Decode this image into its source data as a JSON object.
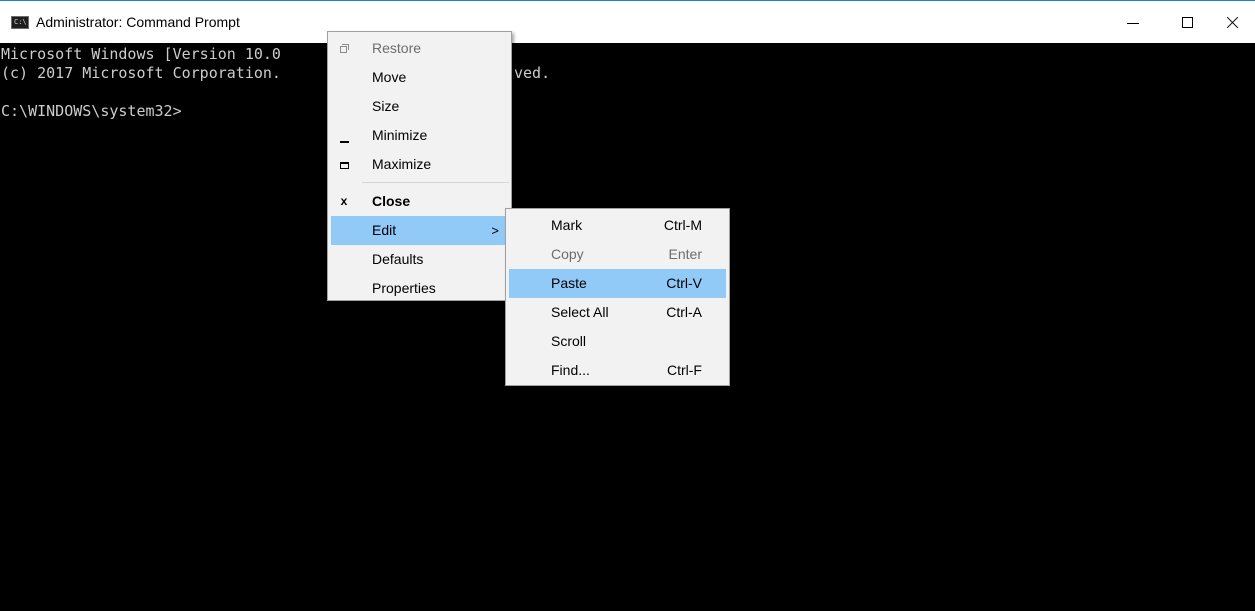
{
  "window": {
    "title": "Administrator: Command Prompt",
    "icon": "cmd-icon",
    "icon_text": "C:\\",
    "controls": {
      "minimize": "minimize-icon",
      "maximize": "maximize-icon",
      "close": "close-icon"
    }
  },
  "console": {
    "lines": [
      "Microsoft Windows [Version 10.0",
      "(c) 2017 Microsoft Corporation.",
      "",
      "C:\\WINDOWS\\system32>"
    ],
    "hidden_fragment": "ved.",
    "colors": {
      "background": "#000000",
      "text": "#cccccc"
    }
  },
  "system_menu": {
    "items": [
      {
        "label": "Restore",
        "icon": "restore-icon",
        "disabled": true
      },
      {
        "label": "Move"
      },
      {
        "label": "Size"
      },
      {
        "label": "Minimize",
        "icon": "minimize-icon"
      },
      {
        "label": "Maximize",
        "icon": "maximize-icon"
      },
      {
        "label": "Close",
        "icon": "close-icon",
        "icon_glyph": "x",
        "bold": true
      },
      {
        "label": "Edit",
        "has_submenu": true,
        "arrow": ">",
        "highlighted": true
      },
      {
        "label": "Defaults"
      },
      {
        "label": "Properties"
      }
    ]
  },
  "edit_submenu": {
    "items": [
      {
        "label": "Mark",
        "shortcut": "Ctrl-M"
      },
      {
        "label": "Copy",
        "shortcut": "Enter",
        "disabled": true
      },
      {
        "label": "Paste",
        "shortcut": "Ctrl-V",
        "highlighted": true
      },
      {
        "label": "Select All",
        "shortcut": "Ctrl-A"
      },
      {
        "label": "Scroll",
        "shortcut": ""
      },
      {
        "label": "Find...",
        "shortcut": "Ctrl-F"
      }
    ]
  },
  "colors": {
    "highlight": "#91c9f7",
    "menu_background": "#f2f2f2",
    "window_border": "#1883d7",
    "disabled_text": "#6d6d6d"
  }
}
